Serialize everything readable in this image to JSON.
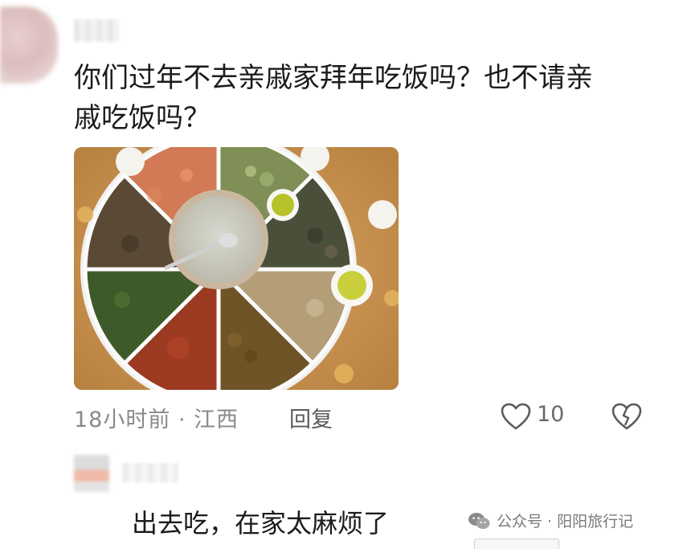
{
  "comment": {
    "text_line1": "你们过年不去亲戚家拜年吃饭吗？也不请亲",
    "text_line2": "戚吃饭吗？",
    "meta": "18小时前 · 江西",
    "reply_label": "回复",
    "like_count": "10",
    "icons": [
      "heart-outline-icon",
      "broken-heart-icon"
    ]
  },
  "reply_comment": {
    "text": "出去吃，在家太麻烦了"
  },
  "watermark": {
    "text": "公众号 · 阳阳旅行记",
    "icon": "wechat-logo"
  },
  "colors": {
    "text": "#1b1b1b",
    "meta": "#8a8a8a",
    "table_wood": "#c9934f"
  }
}
